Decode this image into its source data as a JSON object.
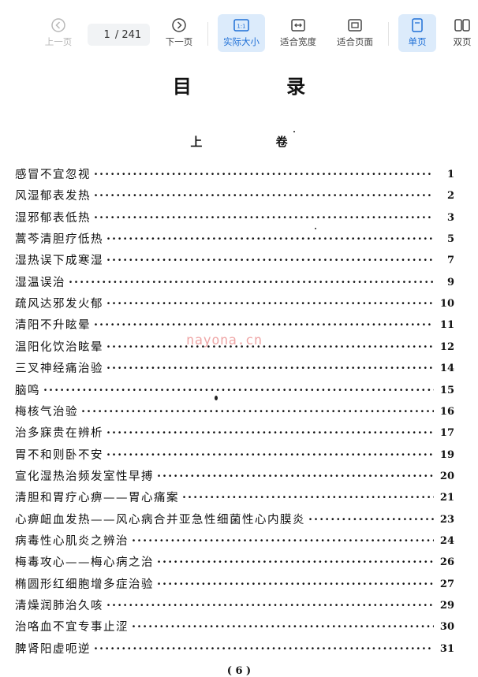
{
  "toolbar": {
    "prev_label": "上一页",
    "current_page": "1",
    "total_pages": "/ 241",
    "next_label": "下一页",
    "actual_size_label": "实际大小",
    "fit_width_label": "适合宽度",
    "fit_page_label": "适合页面",
    "single_page_label": "单页",
    "double_page_label": "双页",
    "accent_color": "#1e6fd6"
  },
  "document": {
    "title": "目 录",
    "volume": "上 卷",
    "watermark": "nayona.cn",
    "page_number": "( 6 )",
    "toc": [
      {
        "title": "感冒不宜忽视",
        "page": "1"
      },
      {
        "title": "风湿郁表发热",
        "page": "2"
      },
      {
        "title": "湿邪郁表低热",
        "page": "3"
      },
      {
        "title": "蒿芩清胆疗低热",
        "page": "5"
      },
      {
        "title": "湿热误下成寒湿",
        "page": "7"
      },
      {
        "title": "湿温误治",
        "page": "9"
      },
      {
        "title": "疏风达邪发火郁",
        "page": "10"
      },
      {
        "title": "清阳不升眩晕",
        "page": "11"
      },
      {
        "title": "温阳化饮治眩晕",
        "page": "12"
      },
      {
        "title": "三叉神经痛治验",
        "page": "14"
      },
      {
        "title": "脑鸣",
        "page": "15"
      },
      {
        "title": "梅核气治验",
        "page": "16"
      },
      {
        "title": "治多寐贵在辨析",
        "page": "17"
      },
      {
        "title": "胃不和则卧不安",
        "page": "19"
      },
      {
        "title": "宣化湿热治频发室性早搏",
        "page": "20"
      },
      {
        "title": "清胆和胃疗心痹——胃心痛案",
        "page": "21"
      },
      {
        "title": "心痹衄血发热——风心病合并亚急性细菌性心内膜炎",
        "page": "23"
      },
      {
        "title": "病毒性心肌炎之辨治",
        "page": "24"
      },
      {
        "title": "梅毒攻心——梅心病之治",
        "page": "26"
      },
      {
        "title": "椭圆形红细胞增多症治验",
        "page": "27"
      },
      {
        "title": "清燥润肺治久咳",
        "page": "29"
      },
      {
        "title": "治咯血不宜专事止涩",
        "page": "30"
      },
      {
        "title": "脾肾阳虚呃逆",
        "page": "31"
      }
    ]
  }
}
